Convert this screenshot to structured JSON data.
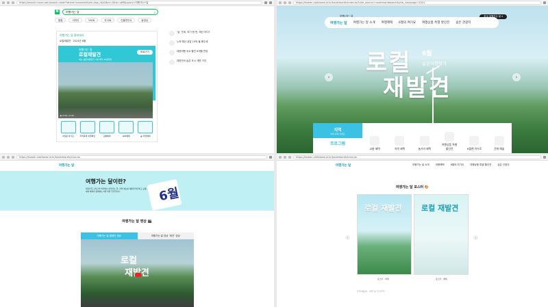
{
  "q1": {
    "url": "https://search.naver.com/search.naver?where=nexearch&sm=top_hty&fbm=0&ie=utf8&query=여행가는+달",
    "query": "여행가는 달",
    "tabs": [
      "통합",
      "이미지",
      "VIEW",
      "지식iN",
      "인플루언서",
      "동영상"
    ],
    "card_head": "여행가는 달 홍보대사",
    "card_sub": "로컬재발견 · 2024년 6월",
    "banner": {
      "brand": "여행가는 달",
      "title": "로컬재발견",
      "sub": "6월, 숨은여행찾기 1일 부터 30일까지",
      "button": "바로가기"
    },
    "video_time": "0:00 / 0:30",
    "icons": [
      "6월원 여기요",
      "지역축제 여행확인",
      "교통혜택",
      "숙박혜택",
      "숲·자연혜택"
    ],
    "side": [
      "‘숲’ 관계, 여기 한 번, 예산 어디?",
      "누적 예산 공감 10억 돌 해주세",
      "대한여행 숙소·할인 6개월 연장",
      "대한민국 숨은 도시 개편 가진"
    ]
  },
  "q2": {
    "url": "https://korean.visitkorea.or.kr/travelmonth/index.do?utm_source=naverbrandsearch&utm_campaign=2024",
    "brand": "여행가는 달",
    "nav": [
      "여행가는 달 소개",
      "여행혜택",
      "6월의 여기요",
      "여행상품 특별 할인전",
      "숨은 관광지"
    ],
    "pill": "한국 여행가는 달 ▾",
    "title1": "로컬",
    "title2": "재발견",
    "badge1": "6월",
    "badge2": "숨은여행찾기",
    "region": {
      "title": "지역",
      "sub": "여행·축제 이벤트",
      "program": "프로그램"
    },
    "cats": [
      "교통 혜택",
      "숙박 혜택",
      "놀거리 혜택",
      "여행상품 특별 할인전",
      "6월엔 여기로",
      "문화 예술"
    ]
  },
  "q3": {
    "url": "https://korean.visitkorea.or.kr/travelmonth/intro.do",
    "logo": "여행가는 달",
    "menu": [
      "여행가는 달 소개",
      "여행혜택",
      "6월의 여기요",
      "여행상품 특별 할인전",
      "숨은 관광지"
    ],
    "heading": "여행가는 달이란?",
    "desc": "대한민국 구석구석 여행하는 여행가는 달, 지역 명소를 새롭게 발견하고 교통·숙박 혜택과 함께하는 6월 여행 주간입니다.",
    "calendar": "6월",
    "section": "여행가는 달 영상 🎬",
    "tab_on": "여행가는 달 캠페인 영상",
    "tab_off": "여행가는 달 영상 ‘재건’ 영상",
    "video_title1": "로컬",
    "video_title2": "재발견"
  },
  "q4": {
    "url": "https://korean.visitkorea.or.kr/travelmonth/intro.do",
    "logo": "여행가는 달",
    "menu": [
      "여행가는 달 소개",
      "여행혜택",
      "6월의 여기요",
      "여행상품 특별 할인전",
      "숨은 관광지"
    ],
    "section": "여행가는 달 포스터 🎨",
    "posters": [
      {
        "title": "로컬 재발견",
        "caption": "포스터 - 여행"
      },
      {
        "title": "로컬 재발견",
        "caption": "포스터 - 혜택"
      }
    ],
    "footer": "한국관광공사 · 여행가는 달 사무국"
  }
}
